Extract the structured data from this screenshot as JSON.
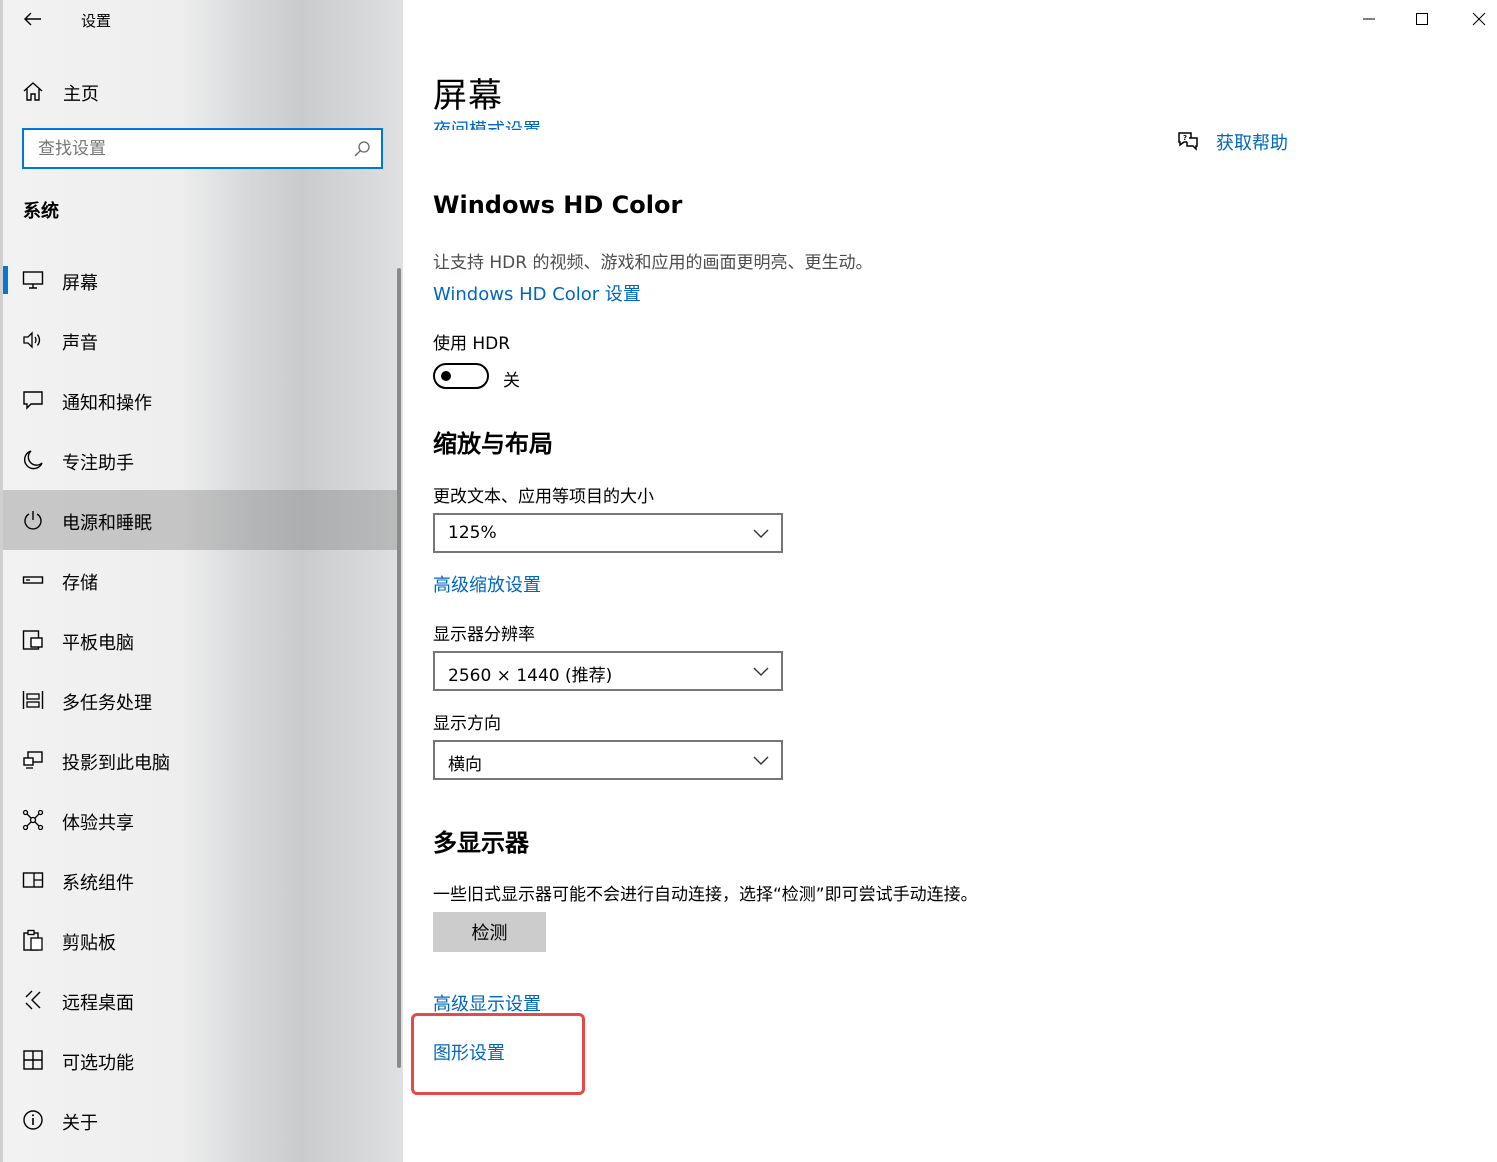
{
  "window": {
    "title": "设置"
  },
  "sidebar": {
    "home_label": "主页",
    "search_placeholder": "查找设置",
    "section_title": "系统",
    "items": [
      {
        "label": "屏幕",
        "icon": "monitor-icon",
        "selected": true
      },
      {
        "label": "声音",
        "icon": "speaker-icon"
      },
      {
        "label": "通知和操作",
        "icon": "notification-icon"
      },
      {
        "label": "专注助手",
        "icon": "moon-icon"
      },
      {
        "label": "电源和睡眠",
        "icon": "power-icon",
        "hovered": true
      },
      {
        "label": "存储",
        "icon": "storage-icon"
      },
      {
        "label": "平板电脑",
        "icon": "tablet-icon"
      },
      {
        "label": "多任务处理",
        "icon": "multitask-icon"
      },
      {
        "label": "投影到此电脑",
        "icon": "project-icon"
      },
      {
        "label": "体验共享",
        "icon": "share-icon"
      },
      {
        "label": "系统组件",
        "icon": "components-icon"
      },
      {
        "label": "剪贴板",
        "icon": "clipboard-icon"
      },
      {
        "label": "远程桌面",
        "icon": "remote-icon"
      },
      {
        "label": "可选功能",
        "icon": "features-icon"
      },
      {
        "label": "关于",
        "icon": "info-icon"
      }
    ]
  },
  "main": {
    "page_title": "屏幕",
    "night_light_link": "夜间模式设置",
    "help_label": "获取帮助",
    "hdr": {
      "heading": "Windows HD Color",
      "description": "让支持 HDR 的视频、游戏和应用的画面更明亮、更生动。",
      "settings_link": "Windows HD Color 设置",
      "use_label": "使用 HDR",
      "toggle_state": "关"
    },
    "scale": {
      "heading": "缩放与布局",
      "size_label": "更改文本、应用等项目的大小",
      "size_value": "125%",
      "advanced_link": "高级缩放设置",
      "resolution_label": "显示器分辨率",
      "resolution_value": "2560 × 1440 (推荐)",
      "orientation_label": "显示方向",
      "orientation_value": "横向"
    },
    "multi": {
      "heading": "多显示器",
      "description": "一些旧式显示器可能不会进行自动连接，选择“检测”即可尝试手动连接。",
      "detect_button": "检测",
      "advanced_display_link": "高级显示设置",
      "graphics_link": "图形设置"
    }
  },
  "colors": {
    "accent": "#0078d7",
    "link": "#0067c0",
    "highlight": "#e34a4a"
  }
}
